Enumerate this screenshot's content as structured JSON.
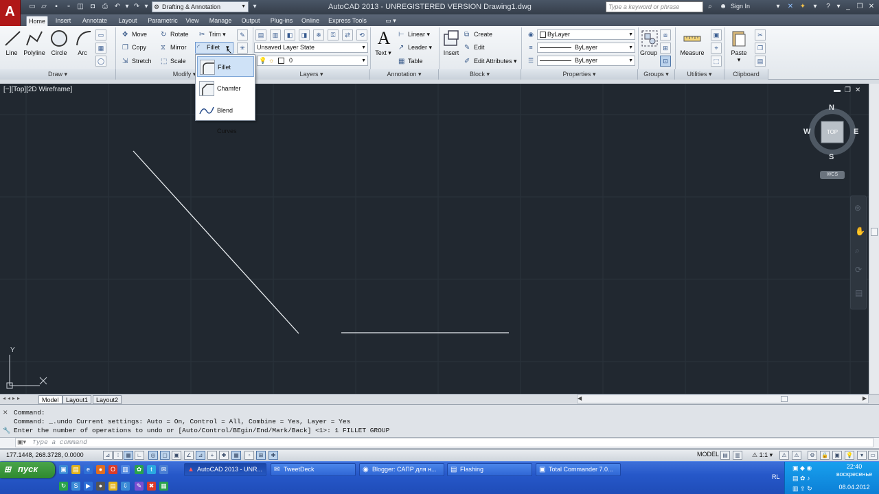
{
  "app": {
    "logo": "A",
    "title": "AutoCAD 2013 - UNREGISTERED VERSION    Drawing1.dwg",
    "workspace": "Drafting & Annotation",
    "search_placeholder": "Type a keyword or phrase",
    "sign_in": "Sign In"
  },
  "tabs": [
    "Home",
    "Insert",
    "Annotate",
    "Layout",
    "Parametric",
    "View",
    "Manage",
    "Output",
    "Plug-ins",
    "Online",
    "Express Tools"
  ],
  "draw": {
    "label": "Draw",
    "tools": [
      "Line",
      "Polyline",
      "Circle",
      "Arc"
    ]
  },
  "modify": {
    "label": "Modify",
    "move": "Move",
    "rotate": "Rotate",
    "trim": "Trim",
    "copy": "Copy",
    "mirror": "Mirror",
    "fillet": "Fillet",
    "stretch": "Stretch",
    "scale": "Scale"
  },
  "layers": {
    "label": "Layers",
    "layer_state": "Unsaved Layer State",
    "current_layer": "0"
  },
  "annotation": {
    "label": "Annotation",
    "text": "Text",
    "linear": "Linear",
    "leader": "Leader",
    "table": "Table"
  },
  "block": {
    "label": "Block",
    "insert": "Insert",
    "create": "Create",
    "edit": "Edit",
    "edit_attributes": "Edit Attributes"
  },
  "properties": {
    "label": "Properties",
    "color": "ByLayer",
    "linetype": "ByLayer",
    "lineweight": "ByLayer"
  },
  "groups": {
    "label": "Groups",
    "group": "Group"
  },
  "utilities": {
    "label": "Utilities",
    "measure": "Measure"
  },
  "clipboard": {
    "label": "Clipboard",
    "paste": "Paste"
  },
  "flyout": {
    "items": [
      "Fillet",
      "Chamfer",
      "Blend Curves"
    ]
  },
  "viewport": {
    "label": "[−][Top][2D Wireframe]",
    "viewcube_top": "TOP",
    "compass": {
      "n": "N",
      "s": "S",
      "e": "E",
      "w": "W"
    },
    "wcs": "WCS",
    "ucs_y": "Y"
  },
  "layout_tabs": [
    "Model",
    "Layout1",
    "Layout2"
  ],
  "command": {
    "history": [
      "Command:",
      "Command: _.undo Current settings: Auto = On, Control = All, Combine = Yes, Layer = Yes",
      "Enter the number of operations to undo or [Auto/Control/BEgin/End/Mark/Back] <1>: 1 FILLET GROUP"
    ],
    "placeholder": "Type a command"
  },
  "status": {
    "coords": "177.1448, 268.3728, 0.0000",
    "model": "MODEL",
    "scale": "1:1"
  },
  "taskbar": {
    "start": "пуск",
    "windows": [
      "AutoCAD 2013 - UNR...",
      "TweetDeck",
      "Blogger: САПР для н...",
      "Flashing",
      "Total Commander 7.0..."
    ],
    "lang": "RL",
    "time": "22:40",
    "day": "воскресенье",
    "date": "08.04.2012"
  },
  "colors": {
    "canvas": "#212830",
    "accent": "#b01818",
    "taskbar": "#2658c9",
    "tray": "#0c7fd6"
  }
}
